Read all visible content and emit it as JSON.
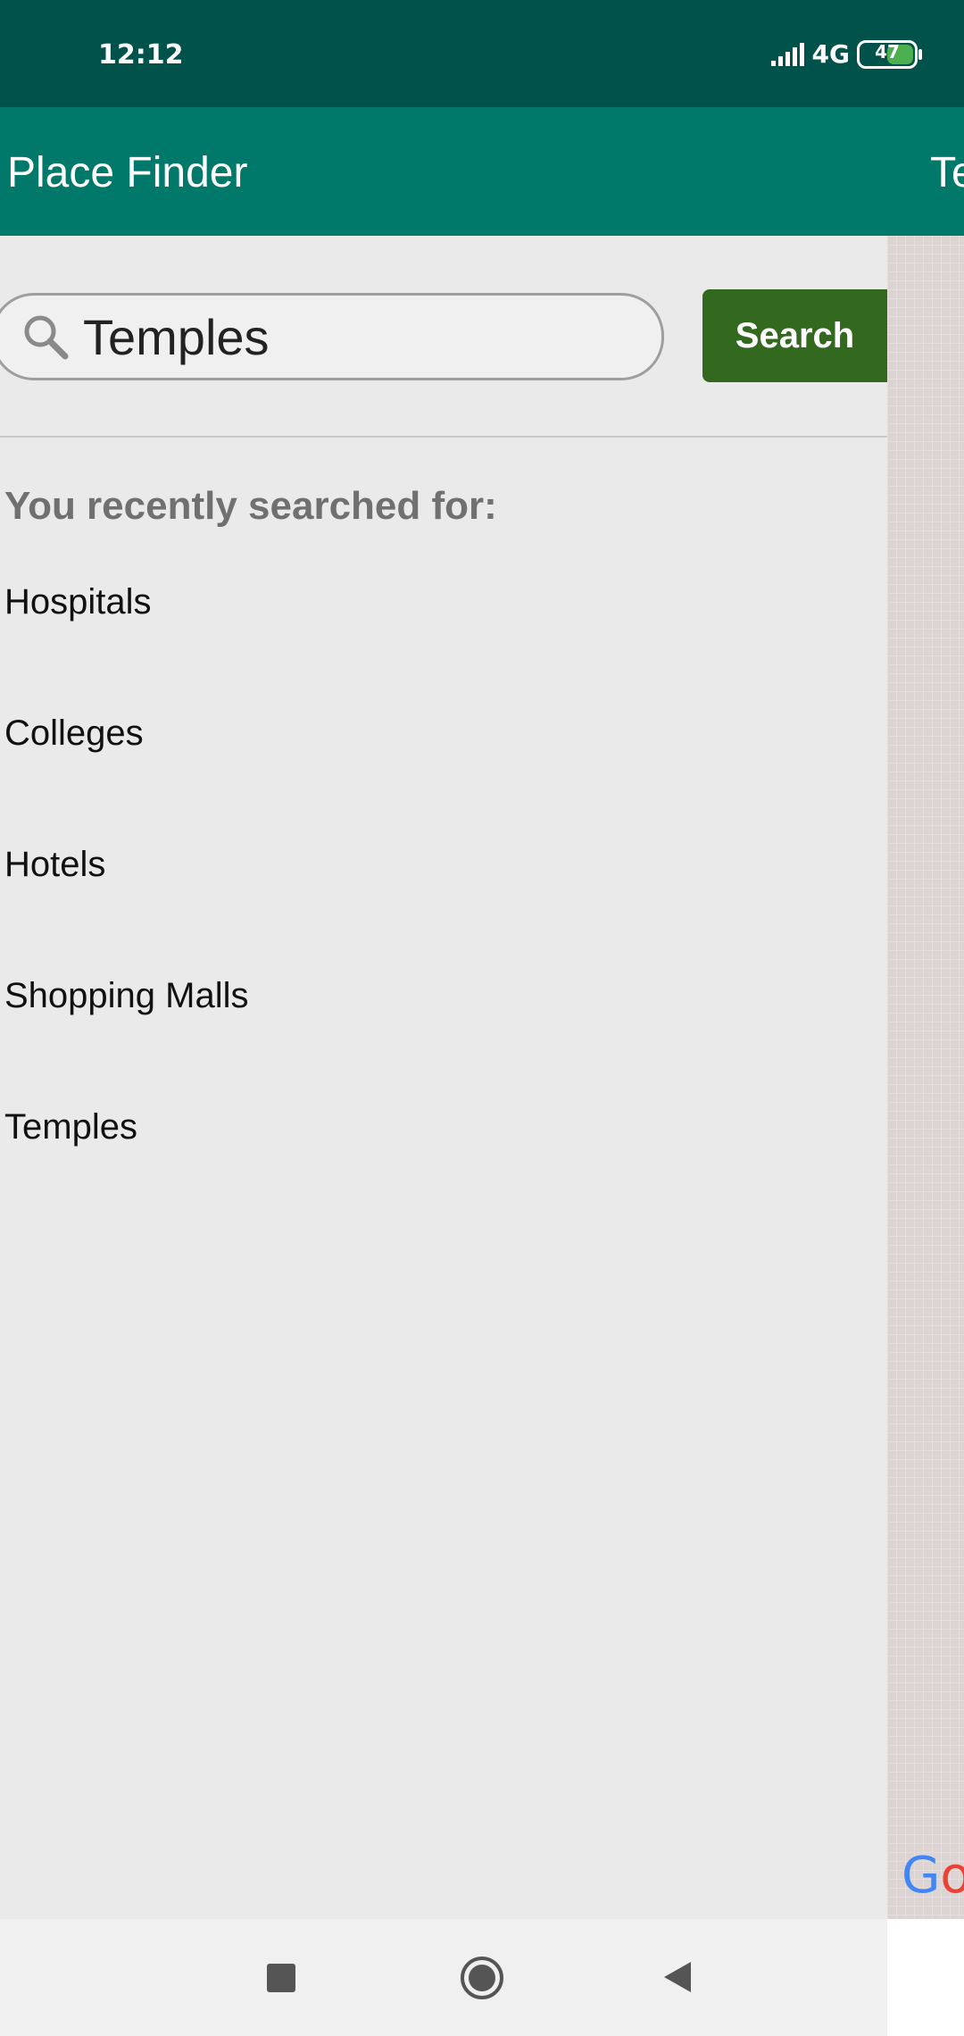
{
  "status_bar": {
    "time": "12:12",
    "network_type": "4G",
    "battery_level": "47",
    "battery_fraction": 0.47,
    "background_color": "#00524A"
  },
  "app_bar": {
    "title": "Place Finder",
    "right_title_fragment": "Te",
    "background_color": "#00796B"
  },
  "search": {
    "icon": "search-icon",
    "value": "Temples",
    "button_label": "Search",
    "button_color": "#33691E"
  },
  "recent": {
    "heading": "You recently searched for:",
    "items": [
      {
        "label": "Hospitals"
      },
      {
        "label": "Colleges"
      },
      {
        "label": "Hotels"
      },
      {
        "label": "Shopping Malls"
      },
      {
        "label": "Temples"
      }
    ]
  },
  "map": {
    "logo_text_blue": "G",
    "logo_text_red": "o"
  },
  "nav_bar": {
    "recents_icon": "square-icon",
    "home_icon": "circle-icon",
    "back_icon": "triangle-back-icon"
  }
}
